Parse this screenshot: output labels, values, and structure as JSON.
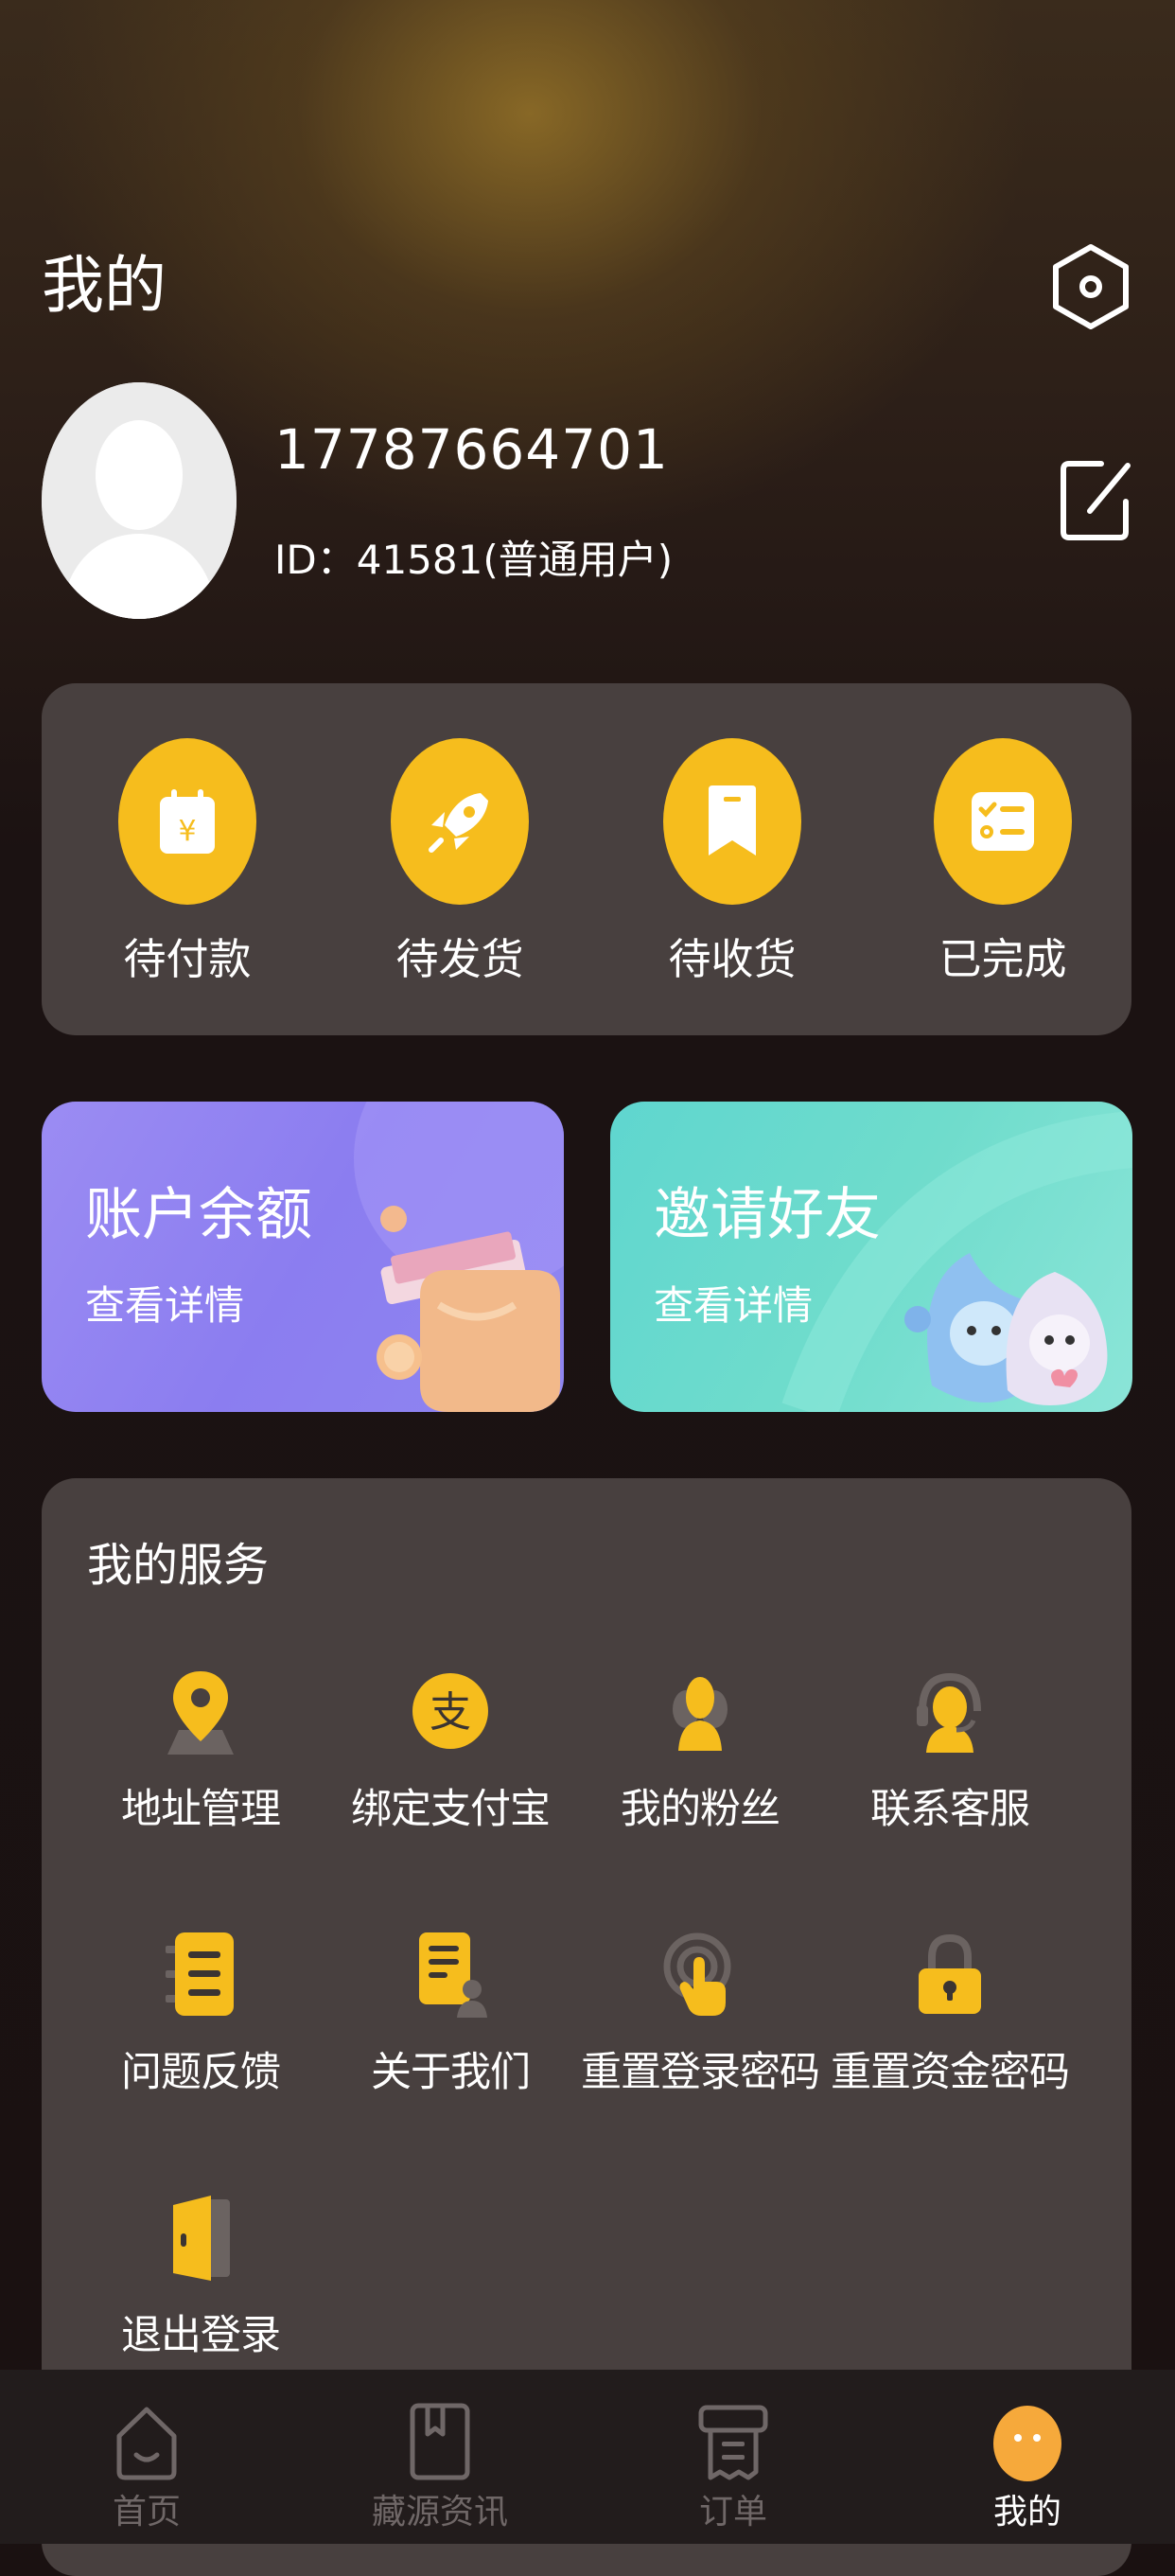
{
  "header": {
    "title": "我的"
  },
  "profile": {
    "phone": "17787664701",
    "id_text": "ID：41581(普通用户)"
  },
  "orders": [
    {
      "label": "待付款",
      "icon": "wallet-yen-icon"
    },
    {
      "label": "待发货",
      "icon": "rocket-icon"
    },
    {
      "label": "待收货",
      "icon": "bookmark-icon"
    },
    {
      "label": "已完成",
      "icon": "checklist-icon"
    }
  ],
  "promos": {
    "balance": {
      "title": "账户余额",
      "subtitle": "查看详情"
    },
    "invite": {
      "title": "邀请好友",
      "subtitle": "查看详情"
    }
  },
  "services": {
    "title": "我的服务",
    "items": [
      {
        "label": "地址管理",
        "icon": "location-pin-icon"
      },
      {
        "label": "绑定支付宝",
        "icon": "alipay-icon"
      },
      {
        "label": "我的粉丝",
        "icon": "fans-icon"
      },
      {
        "label": "联系客服",
        "icon": "customer-service-icon"
      },
      {
        "label": "问题反馈",
        "icon": "feedback-icon"
      },
      {
        "label": "关于我们",
        "icon": "about-icon"
      },
      {
        "label": "重置登录密码",
        "icon": "touch-reset-icon"
      },
      {
        "label": "重置资金密码",
        "icon": "lock-icon"
      },
      {
        "label": "退出登录",
        "icon": "logout-door-icon"
      }
    ]
  },
  "tabbar": [
    {
      "label": "首页",
      "icon": "home-icon"
    },
    {
      "label": "藏源资讯",
      "icon": "book-icon"
    },
    {
      "label": "订单",
      "icon": "receipt-icon"
    },
    {
      "label": "我的",
      "icon": "face-icon"
    }
  ],
  "colors": {
    "accent": "#f6bd1d",
    "card": "#48403f",
    "background": "#1a1111",
    "tab_inactive": "#6f6767"
  }
}
